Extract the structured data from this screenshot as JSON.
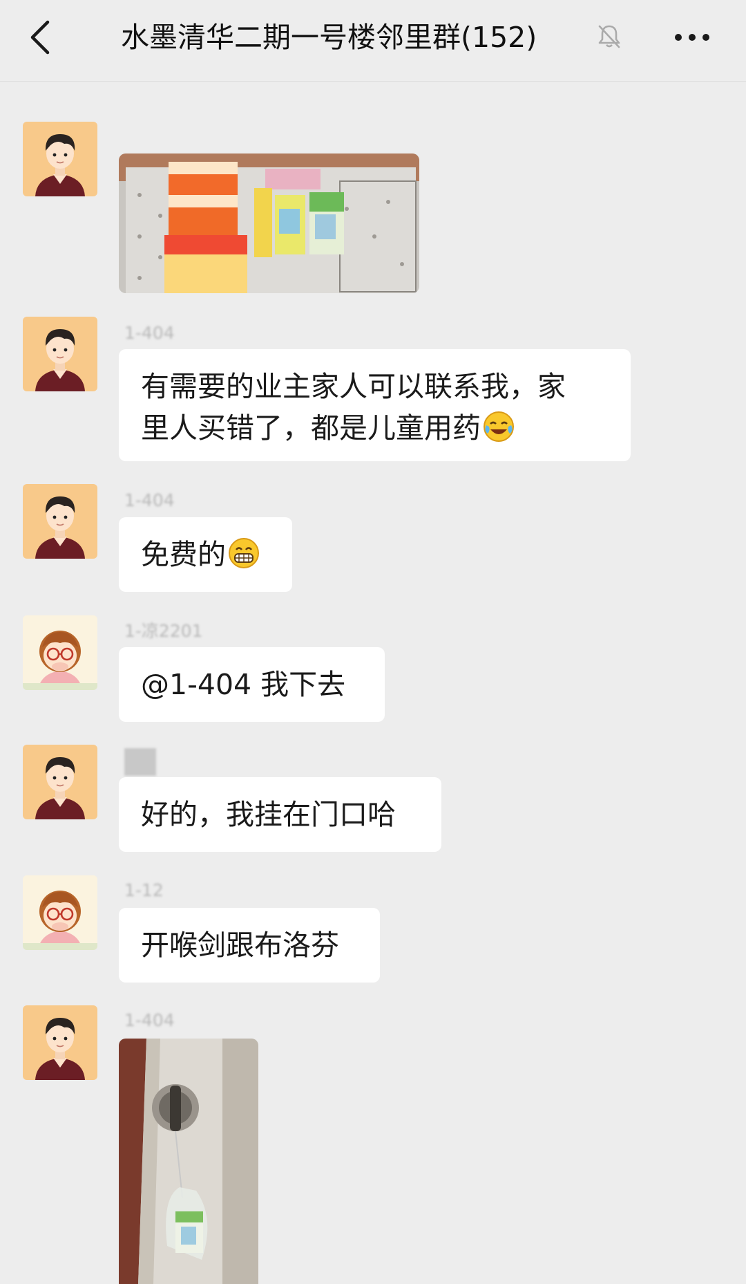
{
  "header": {
    "title": "水墨清华二期一号楼邻里群(152)",
    "back_icon": "chevron-left-icon",
    "mute_icon": "bell-muted-icon",
    "more_icon": "more-dots-icon"
  },
  "messages": [
    {
      "sender": "",
      "type": "image"
    },
    {
      "sender": "1-404",
      "type": "text",
      "lines": [
        "有需要的业主家人可以联系我，家",
        "里人买错了，都是儿童用药"
      ],
      "emoji": "laugh-cry-emoji"
    },
    {
      "sender": "1-404",
      "type": "text",
      "lines": [
        "免费的"
      ],
      "emoji": "grin-emoji"
    },
    {
      "sender": "1-凉2201",
      "type": "text",
      "lines": [
        "@1-404  我下去"
      ]
    },
    {
      "sender": "",
      "type": "text",
      "lines": [
        "好的，我挂在门口哈"
      ]
    },
    {
      "sender": "1-12",
      "type": "text",
      "lines": [
        "开喉剑跟布洛芬"
      ]
    },
    {
      "sender": "1-404",
      "type": "image"
    }
  ],
  "colors": {
    "background": "#ededed",
    "bubble": "#ffffff",
    "text": "#1a1a1a"
  }
}
